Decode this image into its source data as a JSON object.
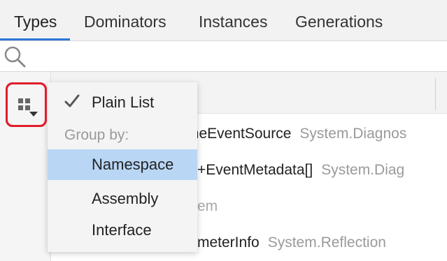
{
  "tabs": [
    {
      "label": "Types",
      "active": true
    },
    {
      "label": "Dominators",
      "active": false
    },
    {
      "label": "Instances",
      "active": false
    },
    {
      "label": "Generations",
      "active": false
    }
  ],
  "search": {
    "value": "",
    "placeholder": ""
  },
  "rows": [
    {
      "name": "meEventSource",
      "namespace": "System.Diagnos"
    },
    {
      "name": "+EventMetadata[]",
      "namespace": "System.Diag"
    },
    {
      "name": "em",
      "namespace": ""
    },
    {
      "name": "meterInfo",
      "namespace": "System.Reflection"
    }
  ],
  "menu": {
    "plain_list": "Plain List",
    "group_by_caption": "Group by:",
    "items": [
      {
        "label": "Namespace",
        "selected": true
      },
      {
        "label": "Assembly",
        "selected": false
      },
      {
        "label": "Interface",
        "selected": false
      }
    ]
  },
  "colors": {
    "accent": "#2b78d6",
    "highlight": "#e01e2a",
    "selection": "#b9d6f5"
  },
  "icons": [
    "search-icon",
    "group-toggle-icon",
    "chevron-down-icon",
    "checkmark-icon"
  ]
}
